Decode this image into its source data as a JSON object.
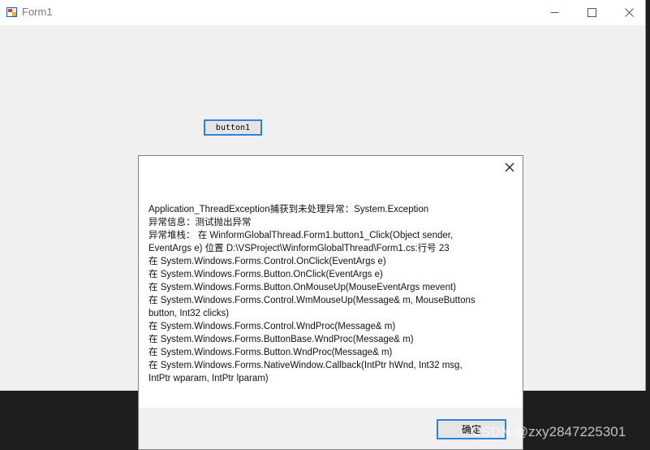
{
  "window": {
    "title": "Form1",
    "minimize_icon": "minimize-icon",
    "maximize_icon": "maximize-icon",
    "close_icon": "close-icon"
  },
  "form": {
    "button1_label": "button1"
  },
  "dialog": {
    "close_icon": "close-icon",
    "message_lines": [
      "Application_ThreadException捕获到未处理异常：System.Exception",
      "异常信息：测试抛出异常",
      "异常堆栈：   在 WinformGlobalThread.Form1.button1_Click(Object sender,",
      "EventArgs e) 位置 D:\\VSProject\\WinformGlobalThread\\Form1.cs:行号 23",
      "   在 System.Windows.Forms.Control.OnClick(EventArgs e)",
      "   在 System.Windows.Forms.Button.OnClick(EventArgs e)",
      "   在 System.Windows.Forms.Button.OnMouseUp(MouseEventArgs mevent)",
      "   在 System.Windows.Forms.Control.WmMouseUp(Message& m, MouseButtons",
      "button, Int32 clicks)",
      "   在 System.Windows.Forms.Control.WndProc(Message& m)",
      "   在 System.Windows.Forms.ButtonBase.WndProc(Message& m)",
      "   在 System.Windows.Forms.Button.WndProc(Message& m)",
      "   在 System.Windows.Forms.NativeWindow.Callback(IntPtr hWnd, Int32 msg,",
      "IntPtr wparam, IntPtr lparam)"
    ],
    "ok_label": "确定"
  },
  "watermark": "CSDN @zxy2847225301",
  "colors": {
    "focus_border": "#2b84d5",
    "window_bg": "#f0f0f0",
    "dark_bg": "#1e1e1e"
  }
}
